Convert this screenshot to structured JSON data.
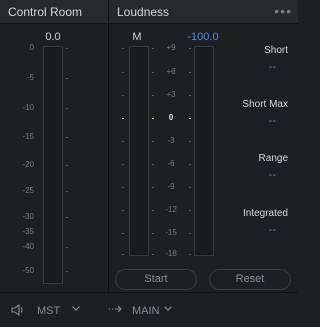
{
  "control_room": {
    "title": "Control Room",
    "value": "0.0",
    "scale": [
      "0",
      "-5",
      "-10",
      "-15",
      "-20",
      "-25",
      "-30",
      "-35",
      "-40",
      "-50"
    ]
  },
  "loudness": {
    "title": "Loudness",
    "menu_icon": "more-dots-icon",
    "meter_label": "M",
    "meter_value": "-100.0",
    "scale": [
      "+9",
      "+6",
      "+3",
      "0",
      "-3",
      "-6",
      "-9",
      "-12",
      "-15",
      "-18"
    ],
    "stats": [
      {
        "label": "Short",
        "value": "--"
      },
      {
        "label": "Short Max",
        "value": "--"
      },
      {
        "label": "Range",
        "value": "--"
      },
      {
        "label": "Integrated",
        "value": "--"
      }
    ],
    "start_label": "Start",
    "reset_label": "Reset"
  },
  "footer": {
    "speaker_icon": "speaker-icon",
    "mst_label": "MST",
    "arrow_icon": "route-arrow-icon",
    "main_label": "MAIN"
  }
}
